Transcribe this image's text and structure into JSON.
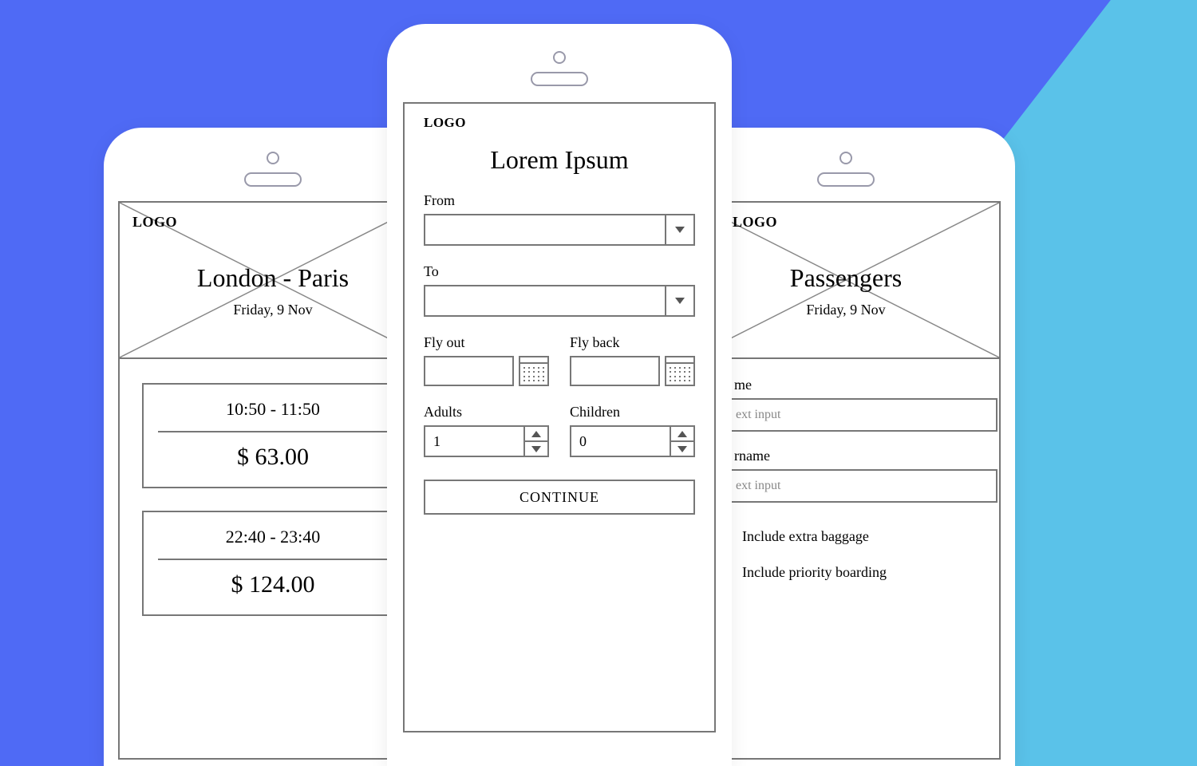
{
  "common": {
    "logo_label": "LOGO",
    "date_sub": "Friday, 9 Nov"
  },
  "left": {
    "title": "London - Paris",
    "flights": [
      {
        "times": "10:50 - 11:50",
        "price": "$ 63.00"
      },
      {
        "times": "22:40 - 23:40",
        "price": "$ 124.00"
      }
    ]
  },
  "center": {
    "title": "Lorem Ipsum",
    "from_label": "From",
    "to_label": "To",
    "flyout_label": "Fly out",
    "flyback_label": "Fly back",
    "adults_label": "Adults",
    "adults_value": "1",
    "children_label": "Children",
    "children_value": "0",
    "continue_label": "CONTINUE"
  },
  "right": {
    "title": "Passengers",
    "name_label": "me",
    "name_placeholder": "ext input",
    "surname_label": "rname",
    "surname_placeholder": "ext input",
    "opt_baggage": "Include extra baggage",
    "opt_priority": "Include priority boarding"
  }
}
